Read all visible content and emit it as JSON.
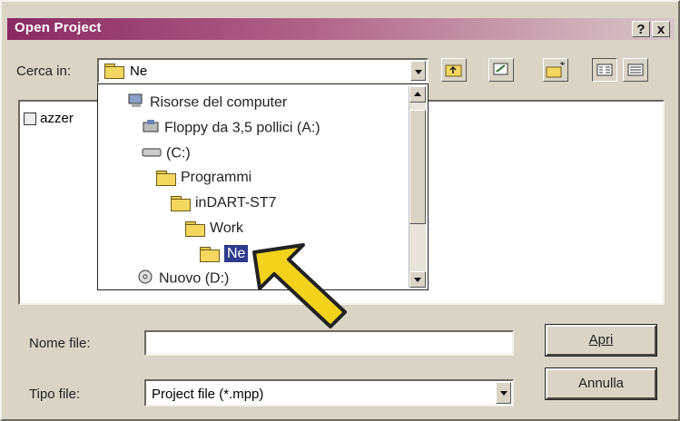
{
  "window": {
    "title": "Open Project"
  },
  "titlebar_buttons": {
    "help": "?",
    "close": "x"
  },
  "look_in": {
    "label": "Cerca in:",
    "value": "Ne"
  },
  "toolbar": {
    "icons": [
      "up-folder-icon",
      "desktop-icon",
      "new-folder-icon",
      "list-view-icon",
      "details-view-icon"
    ]
  },
  "file_list": {
    "items": [
      "azzer"
    ]
  },
  "dropdown": {
    "items": [
      {
        "label": "Risorse del computer",
        "icon": "computer-icon"
      },
      {
        "label": "Floppy da 3,5 pollici (A:)",
        "icon": "floppy-icon"
      },
      {
        "label": "(C:)",
        "icon": "drive-icon"
      },
      {
        "label": "Programmi",
        "icon": "folder-icon"
      },
      {
        "label": "inDART-ST7",
        "icon": "folder-icon"
      },
      {
        "label": "Work",
        "icon": "folder-icon"
      },
      {
        "label": "Ne",
        "icon": "open-folder-icon",
        "selected": true
      },
      {
        "label": "Nuovo (D:)",
        "icon": "cd-drive-icon"
      }
    ]
  },
  "filename": {
    "label": "Nome file:",
    "value": ""
  },
  "filetype": {
    "label": "Tipo file:",
    "value": "Project file (*.mpp)"
  },
  "buttons": {
    "open": "Apri",
    "cancel": "Annulla"
  },
  "colors": {
    "title_start": "#8a2a64",
    "arrow": "#f2d21b",
    "selection": "#2d3a8a"
  }
}
